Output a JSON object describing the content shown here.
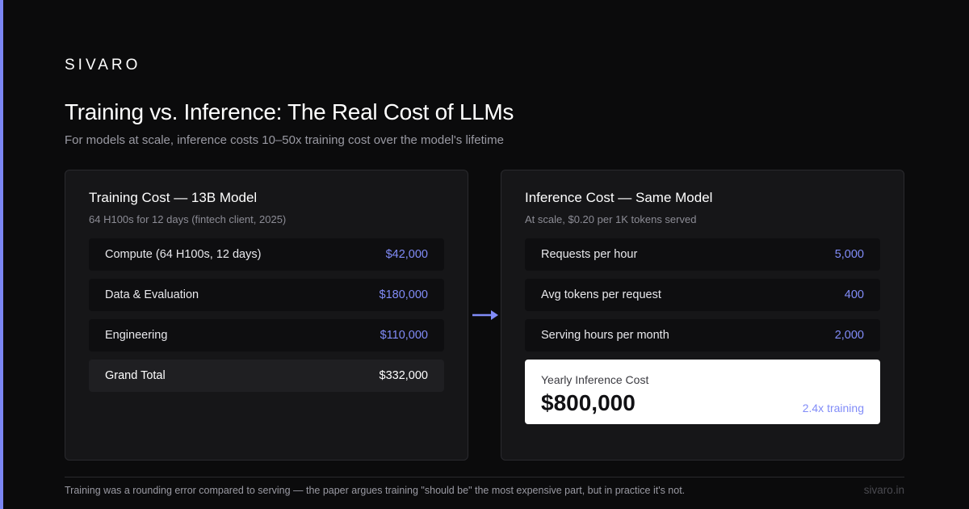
{
  "brand": {
    "logo": "SIVARO",
    "site": "sivaro.in"
  },
  "header": {
    "title": "Training vs. Inference: The Real Cost of LLMs",
    "subtitle": "For models at scale, inference costs 10–50x training cost over the model's lifetime"
  },
  "training": {
    "title": "Training Cost — 13B Model",
    "subtitle": "64 H100s for 12 days (fintech client, 2025)",
    "rows": [
      {
        "label": "Compute (64 H100s, 12 days)",
        "value": "$42,000"
      },
      {
        "label": "Data & Evaluation",
        "value": "$180,000"
      },
      {
        "label": "Engineering",
        "value": "$110,000"
      }
    ],
    "total": {
      "label": "Grand Total",
      "value": "$332,000"
    }
  },
  "inference": {
    "title": "Inference Cost — Same Model",
    "subtitle": "At scale, $0.20 per 1K tokens served",
    "rows": [
      {
        "label": "Requests per hour",
        "value": "5,000"
      },
      {
        "label": "Avg tokens per request",
        "value": "400"
      },
      {
        "label": "Serving hours per month",
        "value": "2,000"
      }
    ],
    "yearly": {
      "label": "Yearly Inference Cost",
      "value": "$800,000",
      "ratio": "2.4x training"
    }
  },
  "footer": {
    "note": "Training was a rounding error compared to serving — the paper argues training \"should be\" the most expensive part, but in practice it's not."
  },
  "colors": {
    "accent": "#818cf8",
    "background": "#0b0b0c",
    "card": "#161618"
  },
  "icons": {
    "flow_arrow": "arrow-right-icon"
  }
}
